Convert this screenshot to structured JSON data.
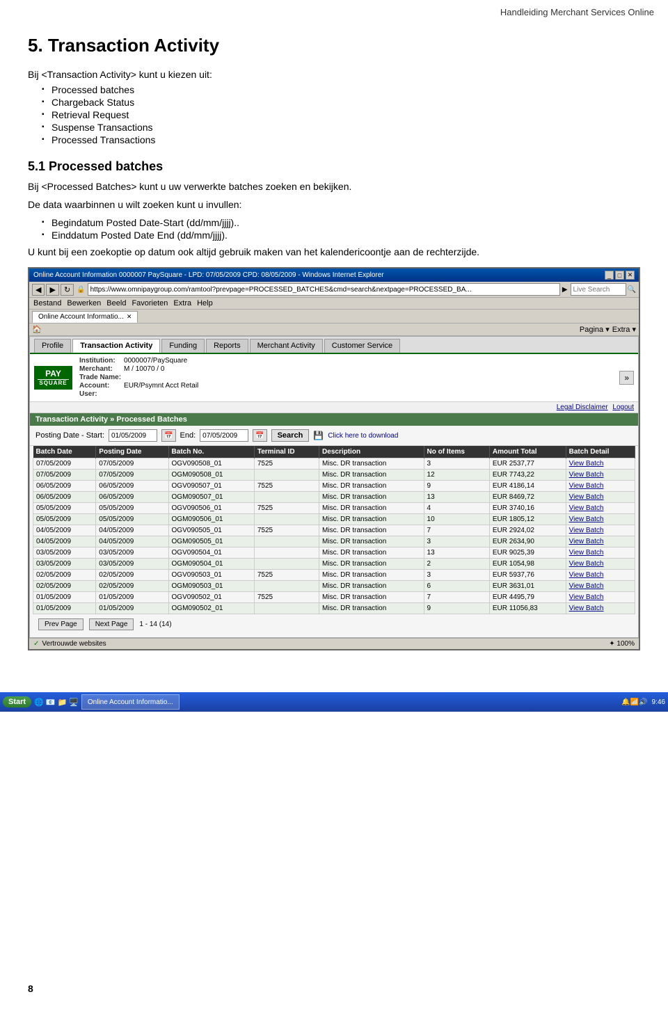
{
  "header": {
    "title": "Handleiding Merchant Services Online"
  },
  "section": {
    "number": "5.",
    "title": "Transaction Activity",
    "intro_label": "Bij <Transaction Activity> kunt u kiezen uit:",
    "menu_items": [
      "Processed batches",
      "Chargeback Status",
      "Retrieval Request",
      "Suspense Transactions",
      "Processed Transactions"
    ],
    "sub_number": "5.1",
    "sub_title": "Processed batches",
    "desc1": "Bij <Processed Batches> kunt u uw verwerkte batches zoeken en bekijken.",
    "desc2_label": "De data waarbinnen u wilt zoeken kunt u invullen:",
    "date_items": [
      "Begindatum Posted Date-Start (dd/mm/jjjj)..",
      "Einddatum Posted Date End (dd/mm/jjjj)."
    ],
    "note": "U kunt bij een zoekoptie op datum ook altijd gebruik maken van het kalendericoontje aan de rechterzijde."
  },
  "browser": {
    "title": "Online Account Information 0000007 PaySquare - LPD: 07/05/2009 CPD: 08/05/2009 - Windows Internet Explorer",
    "url": "https://www.omnipaygroup.com/ramtool?prevpage=PROCESSED_BATCHES&cmd=search&nextpage=PROCESSED_BA...",
    "live_search_placeholder": "Live Search",
    "menu_items": [
      "Bestand",
      "Bewerken",
      "Beeld",
      "Favorieten",
      "Extra",
      "Help"
    ],
    "tab_label": "Online Account Informatio...",
    "toolbar_items": [
      "Pagina ▾",
      "Extra ▾"
    ],
    "nav_tabs": [
      "Profile",
      "Transaction Activity",
      "Funding",
      "Reports",
      "Merchant Activity",
      "Customer Service"
    ],
    "account": {
      "institution_label": "Institution:",
      "institution_value": "0000007/PaySquare",
      "merchant_label": "Merchant:",
      "merchant_value": "M / 10070     / 0",
      "trade_label": "Trade Name:",
      "trade_value": "",
      "account_label": "Account:",
      "account_value": "EUR/Psymnt Acct Retail",
      "user_label": "User:",
      "user_value": ""
    },
    "links": {
      "legal_disclaimer": "Legal Disclaimer",
      "logout": "Logout"
    },
    "breadcrumb": "Transaction Activity » Processed Batches",
    "search_form": {
      "start_label": "Posting Date - Start:",
      "start_value": "01/05/2009",
      "end_label": "End:",
      "end_value": "07/05/2009",
      "search_btn": "Search",
      "download_label": "Click here to download"
    },
    "table": {
      "headers": [
        "Batch Date",
        "Posting Date",
        "Batch No.",
        "Terminal ID",
        "Description",
        "No of Items",
        "Amount Total",
        "Batch Detail"
      ],
      "rows": [
        [
          "07/05/2009",
          "07/05/2009",
          "OGV090508_01",
          "7525",
          "Misc. DR transaction",
          "3",
          "EUR 2537,77",
          "View Batch"
        ],
        [
          "07/05/2009",
          "07/05/2009",
          "OGM090508_01",
          "",
          "Misc. DR transaction",
          "12",
          "EUR 7743,22",
          "View Batch"
        ],
        [
          "06/05/2009",
          "06/05/2009",
          "OGV090507_01",
          "7525",
          "Misc. DR transaction",
          "9",
          "EUR 4186,14",
          "View Batch"
        ],
        [
          "06/05/2009",
          "06/05/2009",
          "OGM090507_01",
          "",
          "Misc. DR transaction",
          "13",
          "EUR 8469,72",
          "View Batch"
        ],
        [
          "05/05/2009",
          "05/05/2009",
          "OGV090506_01",
          "7525",
          "Misc. DR transaction",
          "4",
          "EUR 3740,16",
          "View Batch"
        ],
        [
          "05/05/2009",
          "05/05/2009",
          "OGM090506_01",
          "",
          "Misc. DR transaction",
          "10",
          "EUR 1805,12",
          "View Batch"
        ],
        [
          "04/05/2009",
          "04/05/2009",
          "OGV090505_01",
          "7525",
          "Misc. DR transaction",
          "7",
          "EUR 2924,02",
          "View Batch"
        ],
        [
          "04/05/2009",
          "04/05/2009",
          "OGM090505_01",
          "",
          "Misc. DR transaction",
          "3",
          "EUR 2634,90",
          "View Batch"
        ],
        [
          "03/05/2009",
          "03/05/2009",
          "OGV090504_01",
          "",
          "Misc. DR transaction",
          "13",
          "EUR 9025,39",
          "View Batch"
        ],
        [
          "03/05/2009",
          "03/05/2009",
          "OGM090504_01",
          "",
          "Misc. DR transaction",
          "2",
          "EUR 1054,98",
          "View Batch"
        ],
        [
          "02/05/2009",
          "02/05/2009",
          "OGV090503_01",
          "7525",
          "Misc. DR transaction",
          "3",
          "EUR 5937,76",
          "View Batch"
        ],
        [
          "02/05/2009",
          "02/05/2009",
          "OGM090503_01",
          "",
          "Misc. DR transaction",
          "6",
          "EUR 3631,01",
          "View Batch"
        ],
        [
          "01/05/2009",
          "01/05/2009",
          "OGV090502_01",
          "7525",
          "Misc. DR transaction",
          "7",
          "EUR 4495,79",
          "View Batch"
        ],
        [
          "01/05/2009",
          "01/05/2009",
          "OGM090502_01",
          "",
          "Misc. DR transaction",
          "9",
          "EUR 11056,83",
          "View Batch"
        ]
      ]
    },
    "pagination": {
      "prev_btn": "Prev Page",
      "next_btn": "Next Page",
      "info": "1 - 14 (14)"
    },
    "status_bar": {
      "trusted": "Vertrouwde websites",
      "zoom": "✦ 100%"
    }
  },
  "taskbar": {
    "start": "Start",
    "app_label": "Online Account Informatio...",
    "time": "9:46",
    "taskbar_icons": [
      "🌐",
      "📧",
      "🔔"
    ]
  },
  "page_number": "8"
}
